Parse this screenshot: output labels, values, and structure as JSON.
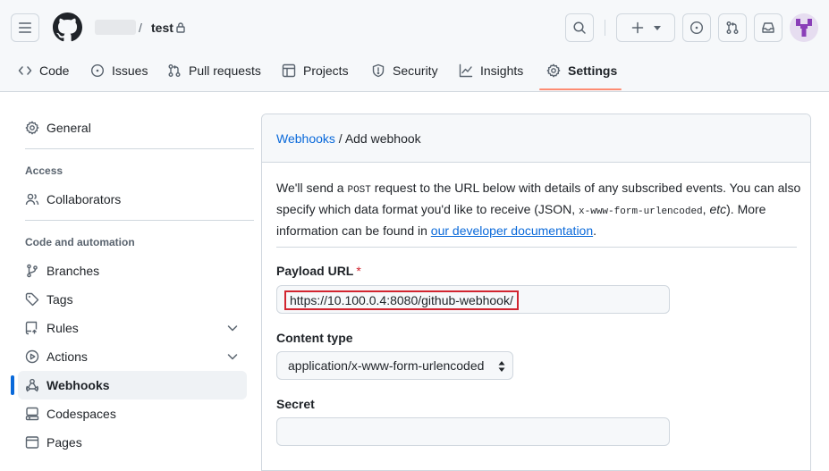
{
  "header": {
    "repo_name": "test",
    "separator": "/"
  },
  "tabs": [
    {
      "label": "Code",
      "icon": "code-icon"
    },
    {
      "label": "Issues",
      "icon": "issue-opened-icon"
    },
    {
      "label": "Pull requests",
      "icon": "git-pull-request-icon"
    },
    {
      "label": "Projects",
      "icon": "table-icon"
    },
    {
      "label": "Security",
      "icon": "shield-icon"
    },
    {
      "label": "Insights",
      "icon": "graph-icon"
    },
    {
      "label": "Settings",
      "icon": "gear-icon",
      "selected": true
    }
  ],
  "sidebar": {
    "general": "General",
    "access_heading": "Access",
    "collaborators": "Collaborators",
    "code_heading": "Code and automation",
    "items": [
      {
        "label": "Branches",
        "icon": "git-branch-icon"
      },
      {
        "label": "Tags",
        "icon": "tag-icon"
      },
      {
        "label": "Rules",
        "icon": "repo-push-icon",
        "expandable": true
      },
      {
        "label": "Actions",
        "icon": "play-icon",
        "expandable": true
      },
      {
        "label": "Webhooks",
        "icon": "webhook-icon",
        "active": true
      },
      {
        "label": "Codespaces",
        "icon": "codespaces-icon"
      },
      {
        "label": "Pages",
        "icon": "browser-icon"
      }
    ]
  },
  "panel": {
    "breadcrumb_link": "Webhooks",
    "breadcrumb_sep": " / ",
    "breadcrumb_current": "Add webhook"
  },
  "intro": {
    "t1": "We'll send a ",
    "post": "POST",
    "t2": " request to the URL below with details of any subscribed events. You can also specify which data format you'd like to receive (JSON, ",
    "urlencoded": "x-www-form-urlencoded",
    "t3": ", ",
    "etc": "etc",
    "t4": "). More information can be found in ",
    "doc_link": "our developer documentation",
    "t5": "."
  },
  "form": {
    "payload_label": "Payload URL",
    "required_mark": "*",
    "payload_value": "https://10.100.0.4:8080/github-webhook/",
    "content_type_label": "Content type",
    "content_type_value": "application/x-www-form-urlencoded",
    "secret_label": "Secret",
    "secret_value": ""
  },
  "colors": {
    "accent": "#0969da",
    "tab_underline": "#fd8c73",
    "highlight_box": "#d1242f"
  }
}
